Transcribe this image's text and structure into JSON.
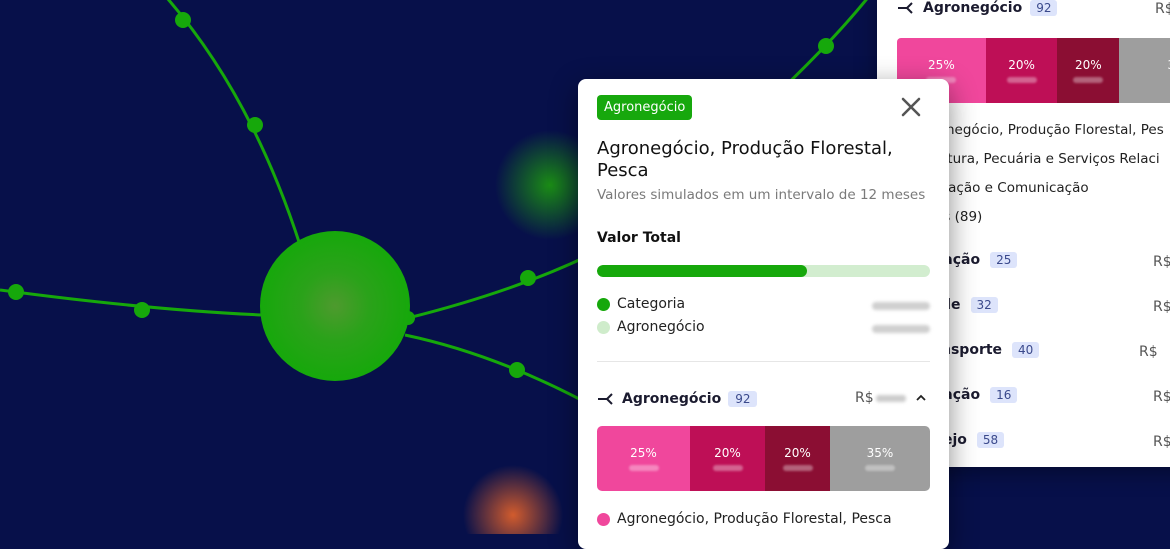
{
  "card": {
    "tag": "Agronegócio",
    "title": "Agronegócio, Produção Florestal, Pesca",
    "subtitle": "Valores simulados em um intervalo de 12 meses",
    "valor_total_label": "Valor Total",
    "progress_fraction": 0.63,
    "legend": [
      {
        "label": "Categoria",
        "color": "#16a80b"
      },
      {
        "label": "Agronegócio",
        "color": "#cfeccb"
      }
    ],
    "group": {
      "label": "Agronegócio",
      "count": "92",
      "currency": "R$"
    },
    "segments": [
      {
        "pct": "25%",
        "color": "#f0479c"
      },
      {
        "pct": "20%",
        "color": "#be0f56"
      },
      {
        "pct": "20%",
        "color": "#8b0e33"
      },
      {
        "pct": "35%",
        "color": "#9e9e9e"
      }
    ],
    "footer_item": {
      "label": "Agronegócio, Produção Florestal, Pesca",
      "color": "#f0479c"
    }
  },
  "back_panel": {
    "header": {
      "label": "Agronegócio",
      "count": "92",
      "currency": "R$"
    },
    "segments": [
      {
        "pct": "25%",
        "color": "#f0479c"
      },
      {
        "pct": "20%",
        "color": "#be0f56"
      },
      {
        "pct": "20%",
        "color": "#8b0e33"
      },
      {
        "pct": "3",
        "color": "#9e9e9e"
      }
    ],
    "lines": [
      "negócio, Produção Florestal, Pes",
      "ultura, Pecuária e Serviços Relaci",
      "mação e Comunicação",
      "os (89)"
    ],
    "rows": [
      {
        "label": "cação",
        "count": "25",
        "currency": "R$"
      },
      {
        "label": "de",
        "count": "32",
        "currency": "R$"
      },
      {
        "label": "nsporte",
        "count": "40",
        "currency": "R$"
      },
      {
        "label": "cação",
        "count": "16",
        "currency": "R$"
      },
      {
        "label": "ejo",
        "count": "58",
        "currency": "R$"
      }
    ]
  },
  "colors": {
    "background": "#07104a",
    "network": "#16a80b"
  }
}
